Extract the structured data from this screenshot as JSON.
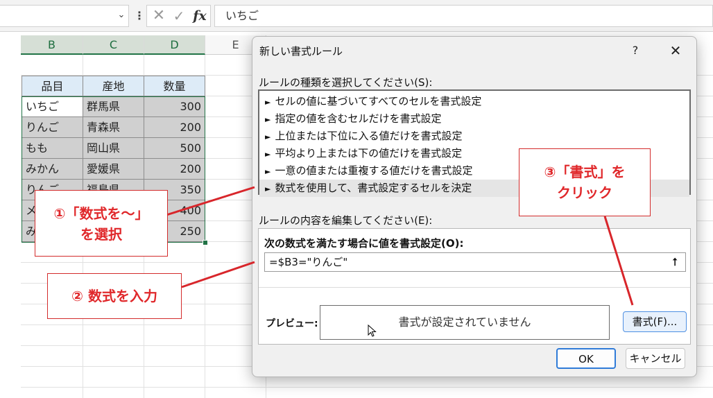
{
  "formula_bar": {
    "formula_text": "いちご",
    "cancel_glyph": "✕",
    "enter_glyph": "✓",
    "fx_glyph": "fx",
    "namebox_chevron": "⌄",
    "more_glyph": "⋮"
  },
  "columns": {
    "b": "B",
    "c": "C",
    "d": "D",
    "e": "E"
  },
  "table": {
    "headers": [
      "品目",
      "産地",
      "数量"
    ],
    "rows": [
      [
        "いちご",
        "群馬県",
        "300"
      ],
      [
        "りんご",
        "青森県",
        "200"
      ],
      [
        "もも",
        "岡山県",
        "500"
      ],
      [
        "みかん",
        "愛媛県",
        "200"
      ],
      [
        "りんご",
        "福島県",
        "350"
      ],
      [
        "メ",
        "",
        "400"
      ],
      [
        "み",
        "",
        "250"
      ]
    ]
  },
  "dialog": {
    "title": "新しい書式ルール",
    "help": "?",
    "close": "✕",
    "rule_type_label": "ルールの種類を選択してください(S):",
    "rule_types": [
      "セルの値に基づいてすべてのセルを書式設定",
      "指定の値を含むセルだけを書式設定",
      "上位または下位に入る値だけを書式設定",
      "平均より上または下の値だけを書式設定",
      "一意の値または重複する値だけを書式設定",
      "数式を使用して、書式設定するセルを決定"
    ],
    "rule_arrow": "►",
    "selected_rule_index": 5,
    "edit_label": "ルールの内容を編集してください(E):",
    "formula_label": "次の数式を満たす場合に値を書式設定(O):",
    "formula_value": "=$B3=\"りんご\"",
    "collapse_glyph": "⭡",
    "preview_label": "プレビュー:",
    "preview_text": "書式が設定されていません",
    "format_button": "書式(F)...",
    "ok_button": "OK",
    "cancel_button": "キャンセル"
  },
  "annotations": {
    "step1_line1": "①「数式を～」",
    "step1_line2": "を選択",
    "step2": "② 数式を入力",
    "step3_line1": "③「書式」を",
    "step3_line2": "クリック",
    "color": "#e0282b"
  },
  "colors": {
    "header_fill": "#ddebf7",
    "selection_shade": "#d0d0d0",
    "excel_green": "#217346",
    "accent_blue": "#2f7bd8"
  }
}
